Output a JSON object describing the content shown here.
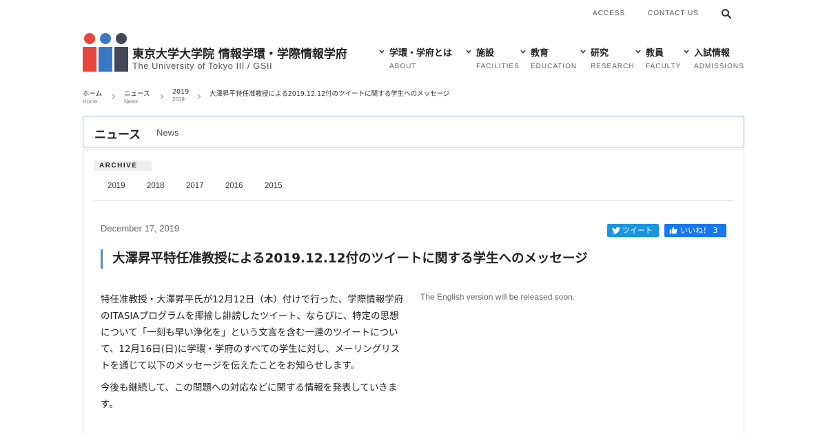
{
  "topbar": {
    "access": "ACCESS",
    "contact": "CONTACT US"
  },
  "header": {
    "title": "東京大学大学院 情報学環・学際情報学府",
    "subtitle": "The University of Tokyo III / GSII",
    "logo_colors": [
      "#e8453c",
      "#3a78c2",
      "#44475a"
    ]
  },
  "nav": [
    {
      "ja": "学環・学府とは",
      "en": "ABOUT"
    },
    {
      "ja": "施設",
      "en": "FACILITIES"
    },
    {
      "ja": "教育",
      "en": "EDUCATION"
    },
    {
      "ja": "研究",
      "en": "RESEARCH"
    },
    {
      "ja": "教員",
      "en": "FACULTY"
    },
    {
      "ja": "入試情報",
      "en": "ADMISSIONS"
    }
  ],
  "breadcrumb": {
    "items": [
      {
        "ja": "ホーム",
        "en": "Home"
      },
      {
        "ja": "ニュース",
        "en": "News"
      },
      {
        "ja": "2019",
        "en": "2019"
      }
    ],
    "current": "大澤昇平特任准教授による2019.12.12付のツイートに関する学生へのメッセージ"
  },
  "section": {
    "title_ja": "ニュース",
    "title_en": "News",
    "accent": "#9ab5c9"
  },
  "archive": {
    "label": "ARCHIVE",
    "years": [
      "2019",
      "2018",
      "2017",
      "2016",
      "2015"
    ]
  },
  "post": {
    "date": "December 17, 2019",
    "tweet_label": "ツイート",
    "like_label": "いいね！ 3",
    "title": "大澤昇平特任准教授による2019.12.12付のツイートに関する学生へのメッセージ",
    "body_ja": [
      "特任准教授・大澤昇平氏が12月12日（木）付けで行った、学際情報学府のITASIAプログラムを揶揄し誹謗したツイート、ならびに、特定の思想について「一刻も早い浄化を」という文言を含む一連のツイートについて、12月16日(日)に学環・学府のすべての学生に対し、メーリングリストを通じて以下のメッセージを伝えたことをお知らせします。",
      "今後も継続して、この問題への対応などに関する情報を発表していきます。"
    ],
    "body_en": "The English version will be released soon.",
    "title_accent": "#5b8bb5"
  },
  "colors": {
    "twitter": "#1b95e0",
    "facebook": "#1877f2"
  }
}
